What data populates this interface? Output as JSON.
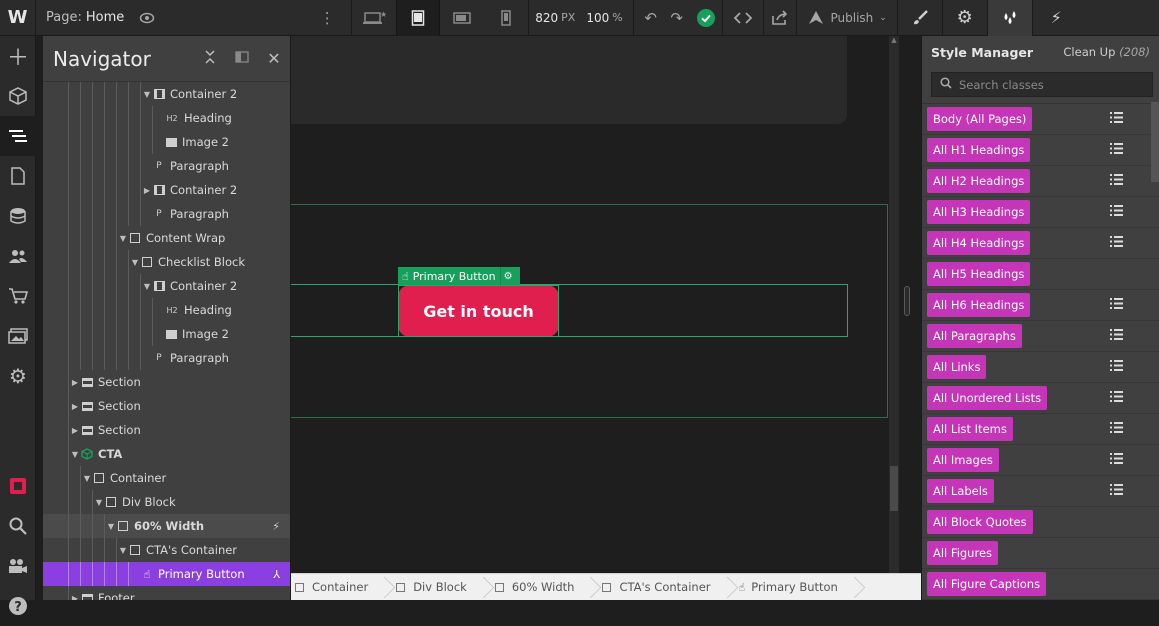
{
  "topbar": {
    "logo": "W",
    "page_label": "Page:",
    "page_name": "Home",
    "width_value": "820",
    "width_unit": "PX",
    "zoom_value": "100",
    "zoom_unit": "%",
    "publish_label": "Publish",
    "icons": [
      "eye-icon",
      "more-vertical-icon",
      "desktop-star-icon",
      "tablet-icon",
      "tablet-landscape-icon",
      "phone-icon",
      "undo-icon",
      "redo-icon",
      "check-circle-icon",
      "code-icon",
      "export-icon",
      "publish-icon",
      "chevron-down-icon"
    ],
    "status_color": "#17a05b"
  },
  "right_tabs": [
    "brush-icon",
    "gear-icon",
    "drops-icon",
    "bolt-icon"
  ],
  "leftrail": [
    "add-icon",
    "box-icon",
    "navigator-icon",
    "pages-icon",
    "cms-icon",
    "users-icon",
    "ecommerce-icon",
    "assets-icon",
    "settings-icon",
    "record-icon",
    "search-icon",
    "video-icon",
    "help-icon"
  ],
  "navigator": {
    "title": "Navigator",
    "rows": [
      {
        "label": "Container 2",
        "icon": "cont",
        "caret": "▼",
        "level": 7
      },
      {
        "label": "Heading",
        "icon": "h2",
        "caret": "",
        "level": 8
      },
      {
        "label": "Image 2",
        "icon": "img",
        "caret": "",
        "level": 8
      },
      {
        "label": "Paragraph",
        "icon": "p",
        "caret": "",
        "level": 7
      },
      {
        "label": "Container 2",
        "icon": "cont",
        "caret": "▶",
        "level": 7
      },
      {
        "label": "Paragraph",
        "icon": "p",
        "caret": "",
        "level": 7
      },
      {
        "label": "Content Wrap",
        "icon": "box",
        "caret": "▼",
        "level": 5
      },
      {
        "label": "Checklist Block",
        "icon": "box",
        "caret": "▼",
        "level": 6
      },
      {
        "label": "Container 2",
        "icon": "cont",
        "caret": "▼",
        "level": 7
      },
      {
        "label": "Heading",
        "icon": "h2",
        "caret": "",
        "level": 8
      },
      {
        "label": "Image 2",
        "icon": "img",
        "caret": "",
        "level": 8
      },
      {
        "label": "Paragraph",
        "icon": "p",
        "caret": "",
        "level": 7
      },
      {
        "label": "Section",
        "icon": "sect",
        "caret": "▶",
        "level": 1
      },
      {
        "label": "Section",
        "icon": "sect",
        "caret": "▶",
        "level": 1
      },
      {
        "label": "Section",
        "icon": "sect",
        "caret": "▶",
        "level": 1
      },
      {
        "label": "CTA",
        "icon": "cta",
        "caret": "▼",
        "level": 1
      },
      {
        "label": "Container",
        "icon": "box",
        "caret": "▼",
        "level": 2
      },
      {
        "label": "Div Block",
        "icon": "box",
        "caret": "▼",
        "level": 3
      },
      {
        "label": "60% Width",
        "icon": "box",
        "caret": "▼",
        "level": 4
      },
      {
        "label": "CTA's Container",
        "icon": "box",
        "caret": "▼",
        "level": 5
      },
      {
        "label": "Primary Button",
        "icon": "hand",
        "caret": "",
        "level": 6
      },
      {
        "label": "Footer",
        "icon": "sect",
        "caret": "▶",
        "level": 1
      }
    ]
  },
  "canvas": {
    "selected_label": "Primary Button",
    "button_text": "Get in touch",
    "accent": "#e01f4f",
    "selection_color": "#17a05b"
  },
  "breadcrumbs": [
    "Container",
    "Div Block",
    "60% Width",
    "CTA's Container",
    "Primary Button"
  ],
  "style_manager": {
    "title": "Style Manager",
    "cleanup_label": "Clean Up",
    "cleanup_count": "(208)",
    "search_placeholder": "Search classes",
    "tag_color": "#c535b7",
    "classes": [
      {
        "label": "Body (All Pages)",
        "menu": true
      },
      {
        "label": "All H1 Headings",
        "menu": true
      },
      {
        "label": "All H2 Headings",
        "menu": true
      },
      {
        "label": "All H3 Headings",
        "menu": true
      },
      {
        "label": "All H4 Headings",
        "menu": true
      },
      {
        "label": "All H5 Headings",
        "menu": false
      },
      {
        "label": "All H6 Headings",
        "menu": true
      },
      {
        "label": "All Paragraphs",
        "menu": true
      },
      {
        "label": "All Links",
        "menu": true
      },
      {
        "label": "All Unordered Lists",
        "menu": true
      },
      {
        "label": "All List Items",
        "menu": true
      },
      {
        "label": "All Images",
        "menu": true
      },
      {
        "label": "All Labels",
        "menu": true
      },
      {
        "label": "All Block Quotes",
        "menu": false
      },
      {
        "label": "All Figures",
        "menu": false
      },
      {
        "label": "All Figure Captions",
        "menu": false
      }
    ]
  }
}
